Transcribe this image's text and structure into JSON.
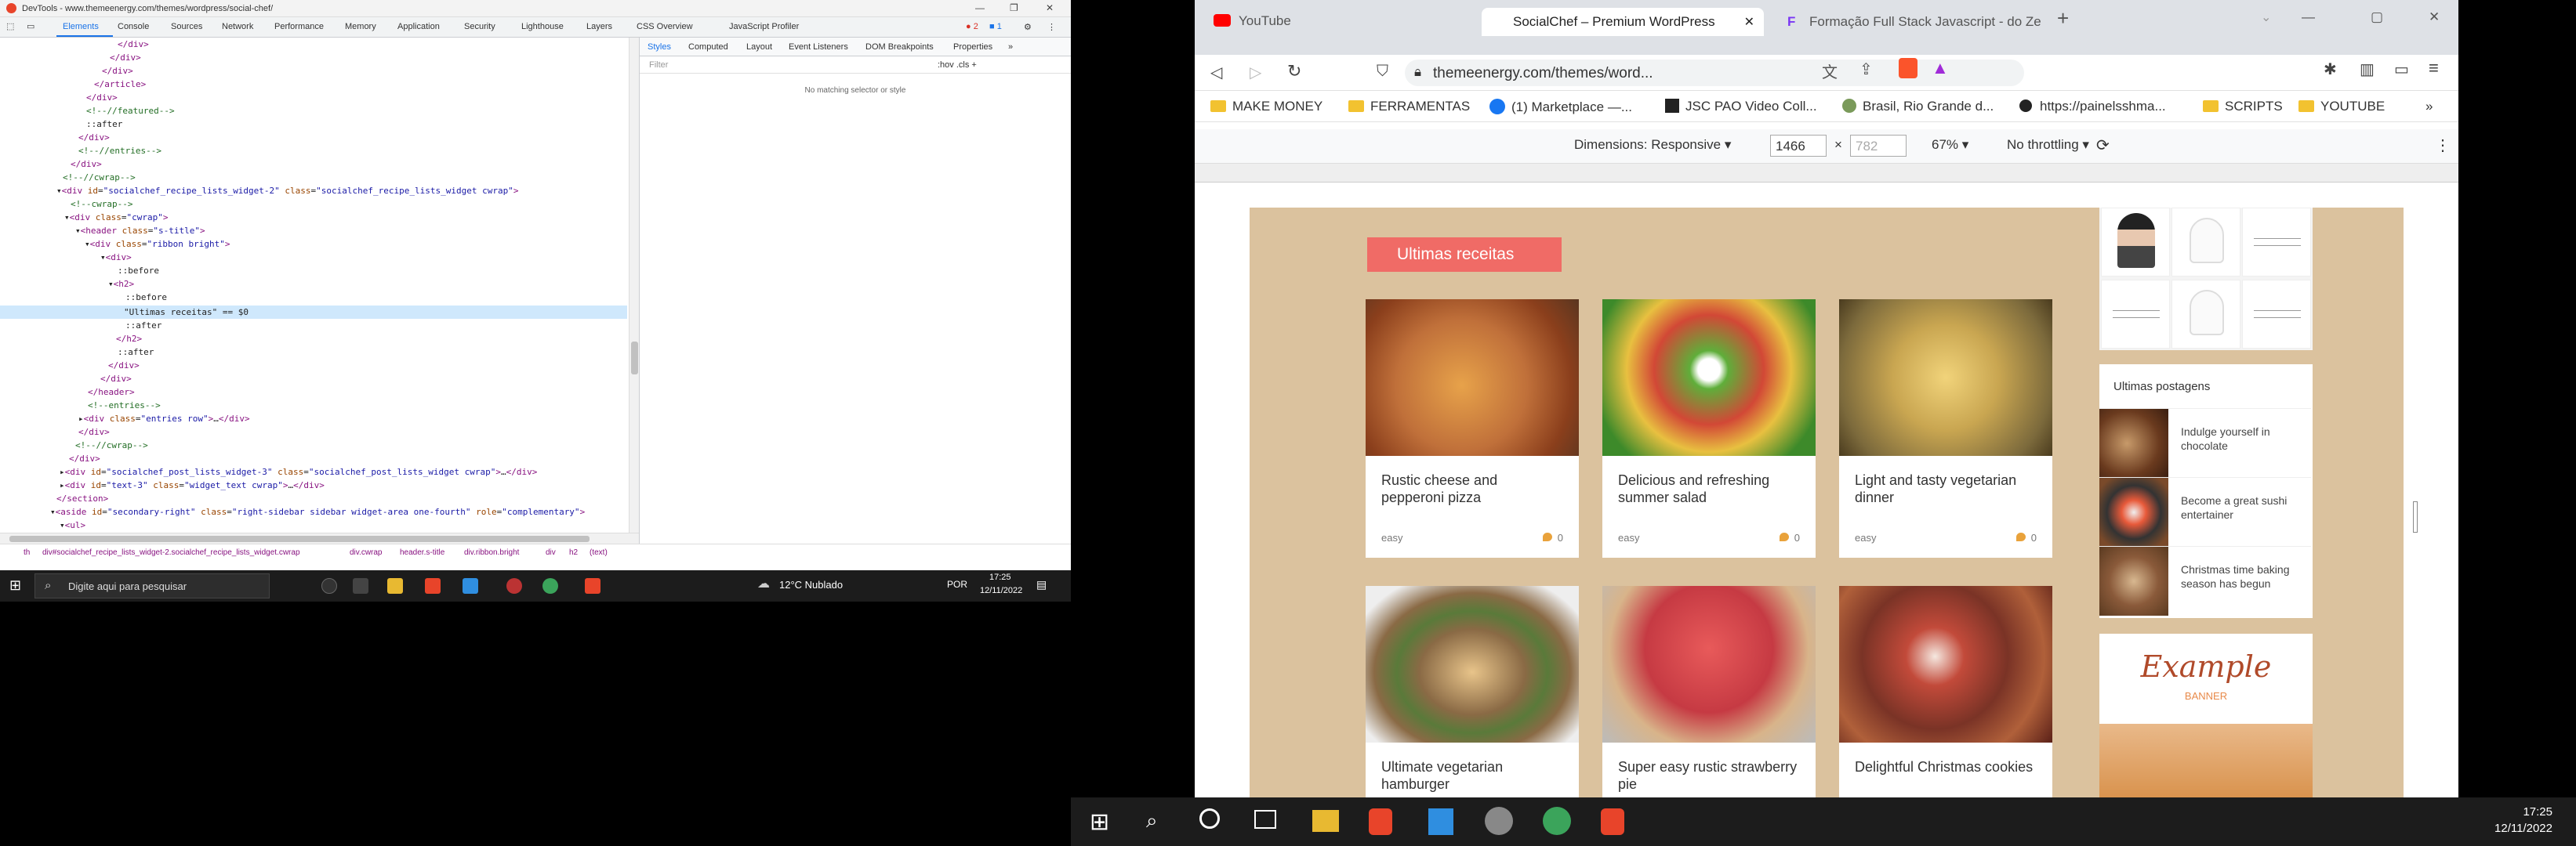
{
  "devtools": {
    "window_title": "DevTools - www.themeenergy.com/themes/wordpress/social-chef/",
    "tabs": [
      "Elements",
      "Console",
      "Sources",
      "Network",
      "Performance",
      "Memory",
      "Application",
      "Security",
      "Lighthouse",
      "Layers",
      "CSS Overview",
      "JavaScript Profiler"
    ],
    "badge_errors": "2",
    "badge_info": "1",
    "styles_tabs": [
      "Styles",
      "Computed",
      "Layout",
      "Event Listeners",
      "DOM Breakpoints",
      "Properties"
    ],
    "filter_placeholder": "Filter",
    "filter_controls": ":hov  .cls  +",
    "no_match": "No matching selector or style",
    "breadcrumbs": [
      "th",
      "div#socialchef_recipe_lists_widget-2.socialchef_recipe_lists_widget.cwrap",
      "div.cwrap",
      "header.s-title",
      "div.ribbon.bright",
      "div",
      "h2",
      "(text)"
    ]
  },
  "taskbar_left": {
    "search": "Digite aqui para pesquisar",
    "weather": "12°C  Nublado",
    "lang": "POR",
    "time": "17:25",
    "date": "12/11/2022"
  },
  "browser": {
    "tabs": [
      "YouTube",
      "SocialChef – Premium WordPress",
      "Formação Full Stack Javascript - do Ze"
    ],
    "url": "themeenergy.com/themes/word...",
    "bookmarks": [
      "MAKE MONEY",
      "FERRAMENTAS",
      "(1) Marketplace —...",
      "JSC PAO Video Coll...",
      "Brasil, Rio Grande d...",
      "https://painelsshma...",
      "SCRIPTS",
      "YOUTUBE"
    ],
    "device_toolbar": {
      "dimensions_label": "Dimensions: Responsive",
      "width": "1466",
      "height": "782",
      "zoom": "67%",
      "throttling": "No throttling"
    }
  },
  "site": {
    "section_title": "Ultimas receitas",
    "recipes": [
      {
        "title": "Rustic cheese and pepperoni pizza",
        "difficulty": "easy",
        "comments": "0",
        "color": "#c0703a"
      },
      {
        "title": "Delicious and refreshing summer salad",
        "difficulty": "easy",
        "comments": "0",
        "color": "#d24836"
      },
      {
        "title": "Light and tasty vegetarian dinner",
        "difficulty": "easy",
        "comments": "0",
        "color": "#c9a651"
      },
      {
        "title": "Ultimate vegetarian hamburger",
        "difficulty": "",
        "comments": "",
        "color": "#8a6a45"
      },
      {
        "title": "Super easy rustic strawberry pie",
        "difficulty": "",
        "comments": "",
        "color": "#c63a43"
      },
      {
        "title": "Delightful Christmas cookies",
        "difficulty": "",
        "comments": "",
        "color": "#7a3326"
      }
    ],
    "posts_title": "Ultimas postagens",
    "posts": [
      {
        "title": "Indulge yourself in chocolate"
      },
      {
        "title": "Become a great sushi entertainer"
      },
      {
        "title": "Christmas time baking season has begun"
      }
    ],
    "banner_title": "Example",
    "banner_sub": "BANNER"
  },
  "taskbar_right": {
    "time": "17:25",
    "date": "12/11/2022"
  }
}
